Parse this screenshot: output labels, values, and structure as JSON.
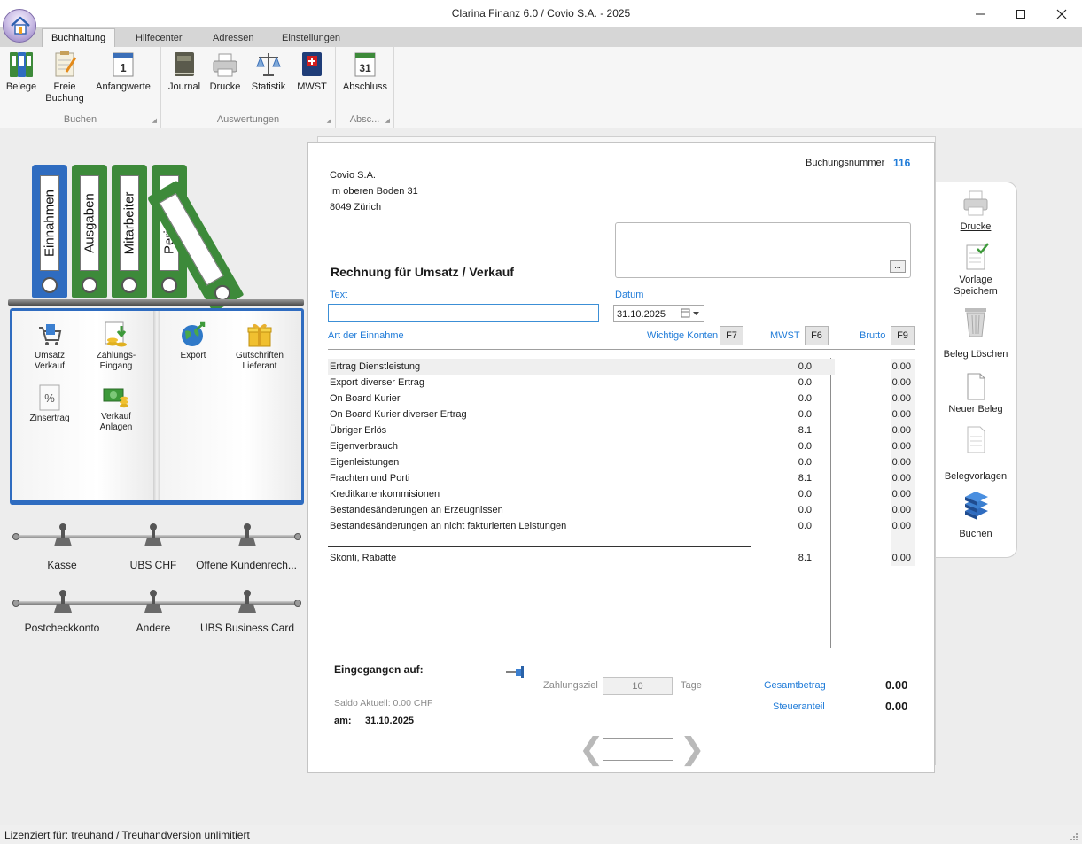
{
  "window": {
    "title": "Clarina Finanz 6.0 / Covio S.A. - 2025"
  },
  "tabs": [
    {
      "label": "Buchhaltung"
    },
    {
      "label": "Hilfecenter"
    },
    {
      "label": "Adressen"
    },
    {
      "label": "Einstellungen"
    }
  ],
  "ribbon": {
    "groups": [
      {
        "label": "Buchen"
      },
      {
        "label": "Auswertungen"
      },
      {
        "label": "Absc..."
      }
    ],
    "buttons": {
      "belege": "Belege",
      "freie_buchung_1": "Freie",
      "freie_buchung_2": "Buchung",
      "anfangswerte": "Anfangwerte",
      "anfangswerte_icon_number": "1",
      "journal": "Journal",
      "drucke": "Drucke",
      "statistik": "Statistik",
      "mwst": "MWST",
      "abschluss": "Abschluss",
      "abschluss_icon_number": "31"
    }
  },
  "binders": [
    {
      "label": "Einnahmen",
      "color": "#2f6cc0"
    },
    {
      "label": "Ausgaben",
      "color": "#3d8a3a"
    },
    {
      "label": "Mitarbeiter",
      "color": "#3d8a3a"
    },
    {
      "label": "Periodisch",
      "color": "#3d8a3a"
    },
    {
      "label": "",
      "color": "#3d8a3a"
    }
  ],
  "book_items": {
    "umsatz_1": "Umsatz",
    "umsatz_2": "Verkauf",
    "zahlungs_1": "Zahlungs-",
    "zahlungs_2": "Eingang",
    "export": "Export",
    "gutschriften_1": "Gutschriften",
    "gutschriften_2": "Lieferant",
    "zinsertrag": "Zinsertrag",
    "verkauf_anlagen_1": "Verkauf",
    "verkauf_anlagen_2": "Anlagen"
  },
  "accounts_row1": [
    "Kasse",
    "UBS CHF",
    "Offene Kundenrech..."
  ],
  "accounts_row2": [
    "Postcheckkonto",
    "Andere",
    "UBS Business Card"
  ],
  "document": {
    "buchungsnummer_label": "Buchungsnummer",
    "buchungsnummer": "116",
    "company": "Covio S.A.",
    "street": "Im oberen Boden 31",
    "city": "8049 Zürich",
    "memo_button": "...",
    "heading": "Rechnung für Umsatz / Verkauf",
    "text_label": "Text",
    "text_value": "",
    "datum_label": "Datum",
    "datum_value": "31.10.2025",
    "art_label": "Art der Einnahme",
    "wichtige_konten_label": "Wichtige Konten",
    "wichtige_konten_key": "F7",
    "mwst_label": "MWST",
    "mwst_key": "F6",
    "brutto_label": "Brutto",
    "brutto_key": "F9",
    "rows": [
      {
        "name": "Ertrag Dienstleistung",
        "mwst": "0.0",
        "brutto": "0.00"
      },
      {
        "name": "Export diverser Ertrag",
        "mwst": "0.0",
        "brutto": "0.00"
      },
      {
        "name": "On Board Kurier",
        "mwst": "0.0",
        "brutto": "0.00"
      },
      {
        "name": "On Board Kurier diverser Ertrag",
        "mwst": "0.0",
        "brutto": "0.00"
      },
      {
        "name": "Übriger Erlös",
        "mwst": "8.1",
        "brutto": "0.00"
      },
      {
        "name": "Eigenverbrauch",
        "mwst": "0.0",
        "brutto": "0.00"
      },
      {
        "name": "Eigenleistungen",
        "mwst": "0.0",
        "brutto": "0.00"
      },
      {
        "name": "Frachten und Porti",
        "mwst": "8.1",
        "brutto": "0.00"
      },
      {
        "name": "Kreditkartenkommisionen",
        "mwst": "0.0",
        "brutto": "0.00"
      },
      {
        "name": "Bestandesänderungen an Erzeugnissen",
        "mwst": "0.0",
        "brutto": "0.00"
      },
      {
        "name": "Bestandesänderungen an nicht fakturierten Leistungen",
        "mwst": "0.0",
        "brutto": "0.00"
      }
    ],
    "skonti_row": {
      "name": "Skonti, Rabatte",
      "mwst": "8.1",
      "brutto": "0.00"
    },
    "eingegangen_label": "Eingegangen auf:",
    "zahlungsziel_label": "Zahlungsziel",
    "zahlungsziel_value": "10",
    "tage_label": "Tage",
    "gesamtbetrag_label": "Gesamtbetrag",
    "gesamtbetrag_value": "0.00",
    "steueranteil_label": "Steueranteil",
    "steueranteil_value": "0.00",
    "saldo_text": "Saldo Aktuell: 0.00 CHF",
    "am_label": "am:",
    "am_value": "31.10.2025",
    "nav_prev": "❮",
    "nav_next": "❯",
    "nav_value": ""
  },
  "right_panel": {
    "drucke": "Drucke",
    "vorlage_1": "Vorlage",
    "vorlage_2": "Speichern",
    "beleg_loeschen": "Beleg Löschen",
    "neuer_beleg": "Neuer Beleg",
    "belegvorlagen": "Belegvorlagen",
    "buchen": "Buchen"
  },
  "status": {
    "text": "Lizenziert für: treuhand / Treuhandversion unlimitiert"
  },
  "colors": {
    "accent_blue": "#1f7bd8",
    "binder_blue": "#2f6cc0",
    "binder_green": "#3d8a3a"
  }
}
